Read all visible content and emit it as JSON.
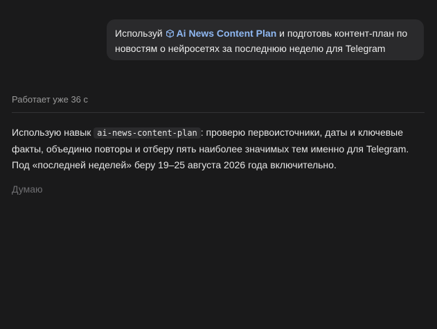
{
  "user_message": {
    "prefix": "Используй",
    "skill_name": "Ai News Content Plan",
    "suffix": " и подготовь контент-план по новостям о нейросетях за последнюю неделю для Telegram",
    "skill_icon": "skill-cube-icon"
  },
  "status": {
    "working_text": "Работает уже 36 с"
  },
  "assistant_message": {
    "before_code": "Использую навык ",
    "code": "ai-news-content-plan",
    "after_code": ": проверю первоисточники, даты и ключевые факты, объединю повторы и отберу пять наиболее значимых тем именно для Telegram. Под «последней неделей» беру 19–25 августа 2026 года включительно."
  },
  "thinking": {
    "label": "Думаю"
  },
  "colors": {
    "background": "#1a1a1b",
    "bubble": "#2a2a2c",
    "skill_accent": "#8fb8f2",
    "muted_text": "#9a9a9a"
  }
}
